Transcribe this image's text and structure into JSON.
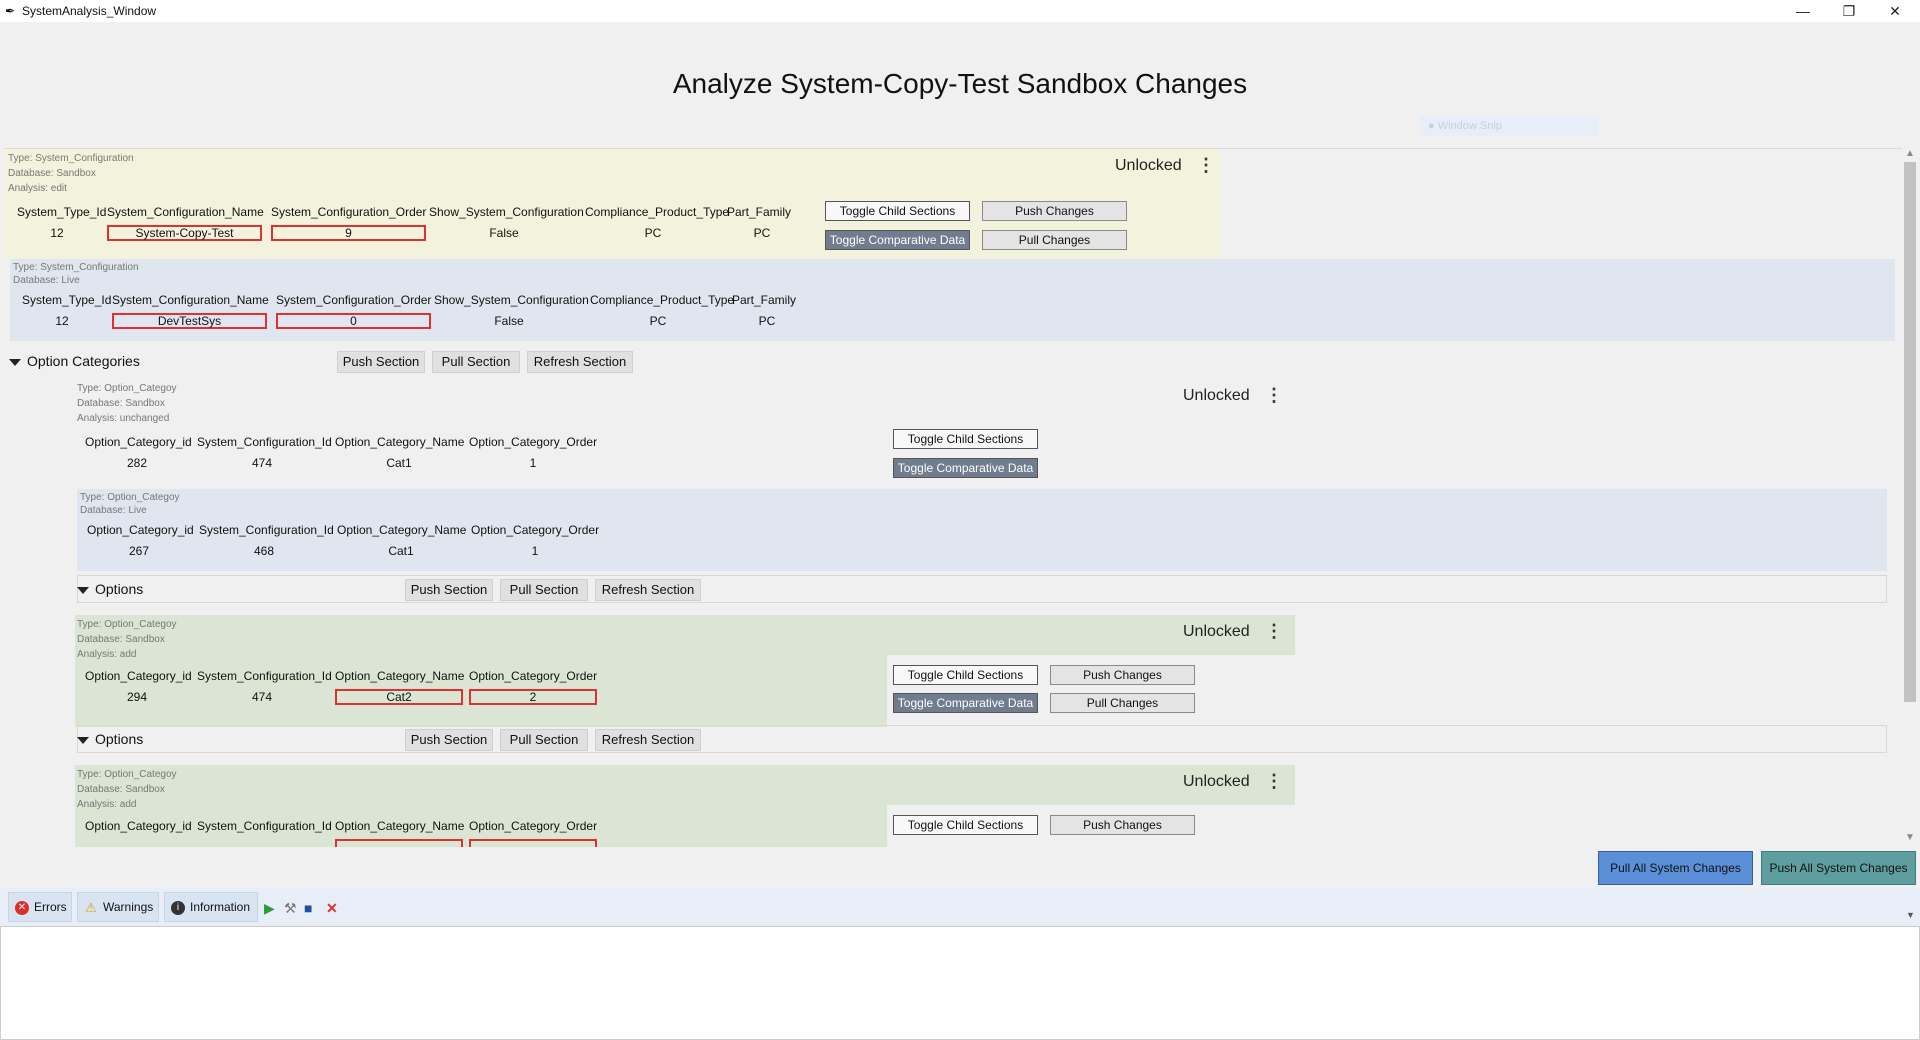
{
  "window": {
    "title": "SystemAnalysis_Window",
    "icon": "pen-icon"
  },
  "heading": "Analyze System-Copy-Test Sandbox Changes",
  "ghost_label": "Window Snip",
  "sys_sandbox": {
    "meta": {
      "type": "Type:  System_Configuration",
      "database": "Database:  Sandbox",
      "analysis": "Analysis:  edit"
    },
    "lock": "Unlocked",
    "headers": [
      "System_Type_Id",
      "System_Configuration_Name",
      "System_Configuration_Order",
      "Show_System_Configuration",
      "Compliance_Product_Type",
      "Part_Family"
    ],
    "values": [
      "12",
      "System-Copy-Test",
      "9",
      "False",
      "PC",
      "PC"
    ],
    "buttons": {
      "toggle_child": "Toggle Child Sections",
      "toggle_compare": "Toggle Comparative Data",
      "push": "Push Changes",
      "pull": "Pull Changes"
    }
  },
  "sys_live": {
    "meta": {
      "type": "Type:  System_Configuration",
      "database": "Database:  Live"
    },
    "headers": [
      "System_Type_Id",
      "System_Configuration_Name",
      "System_Configuration_Order",
      "Show_System_Configuration",
      "Compliance_Product_Type",
      "Part_Family"
    ],
    "values": [
      "12",
      "DevTestSys",
      "0",
      "False",
      "PC",
      "PC"
    ]
  },
  "option_categories": {
    "label": "Option Categories",
    "push": "Push Section",
    "pull": "Pull Section",
    "refresh": "Refresh Section"
  },
  "cat1_sandbox": {
    "meta": {
      "type": "Type:  Option_Categoy",
      "database": "Database:  Sandbox",
      "analysis": "Analysis:  unchanged"
    },
    "lock": "Unlocked",
    "headers": [
      "Option_Category_id",
      "System_Configuration_Id",
      "Option_Category_Name",
      "Option_Category_Order"
    ],
    "values": [
      "282",
      "474",
      "Cat1",
      "1"
    ],
    "buttons": {
      "toggle_child": "Toggle Child Sections",
      "toggle_compare": "Toggle Comparative Data"
    }
  },
  "cat1_live": {
    "meta": {
      "type": "Type:  Option_Categoy",
      "database": "Database:  Live"
    },
    "headers": [
      "Option_Category_id",
      "System_Configuration_Id",
      "Option_Category_Name",
      "Option_Category_Order"
    ],
    "values": [
      "267",
      "468",
      "Cat1",
      "1"
    ]
  },
  "options1": {
    "label": "Options",
    "push": "Push Section",
    "pull": "Pull Section",
    "refresh": "Refresh Section"
  },
  "cat2_sandbox": {
    "meta": {
      "type": "Type:  Option_Categoy",
      "database": "Database:  Sandbox",
      "analysis": "Analysis:  add"
    },
    "lock": "Unlocked",
    "headers": [
      "Option_Category_id",
      "System_Configuration_Id",
      "Option_Category_Name",
      "Option_Category_Order"
    ],
    "values": [
      "294",
      "474",
      "Cat2",
      "2"
    ],
    "buttons": {
      "toggle_child": "Toggle Child Sections",
      "toggle_compare": "Toggle Comparative Data",
      "push": "Push Changes",
      "pull": "Pull Changes"
    }
  },
  "options2": {
    "label": "Options",
    "push": "Push Section",
    "pull": "Pull Section",
    "refresh": "Refresh Section"
  },
  "cat3_sandbox": {
    "meta": {
      "type": "Type:  Option_Categoy",
      "database": "Database:  Sandbox",
      "analysis": "Analysis:  add"
    },
    "lock": "Unlocked",
    "headers": [
      "Option_Category_id",
      "System_Configuration_Id",
      "Option_Category_Name",
      "Option_Category_Order"
    ],
    "buttons": {
      "toggle_child": "Toggle Child Sections",
      "push": "Push Changes"
    }
  },
  "actions": {
    "pull_all": "Pull All System Changes",
    "push_all": "Push All System Changes"
  },
  "bottom_tabs": {
    "errors": "Errors",
    "warnings": "Warnings",
    "information": "Information"
  },
  "colors": {
    "sandbox_edit": "#f3f2dc",
    "live": "#dfe6ef",
    "sandbox_add": "#dae6d3",
    "pull_all": "#5b8fd8",
    "push_all": "#5f9ea0"
  }
}
